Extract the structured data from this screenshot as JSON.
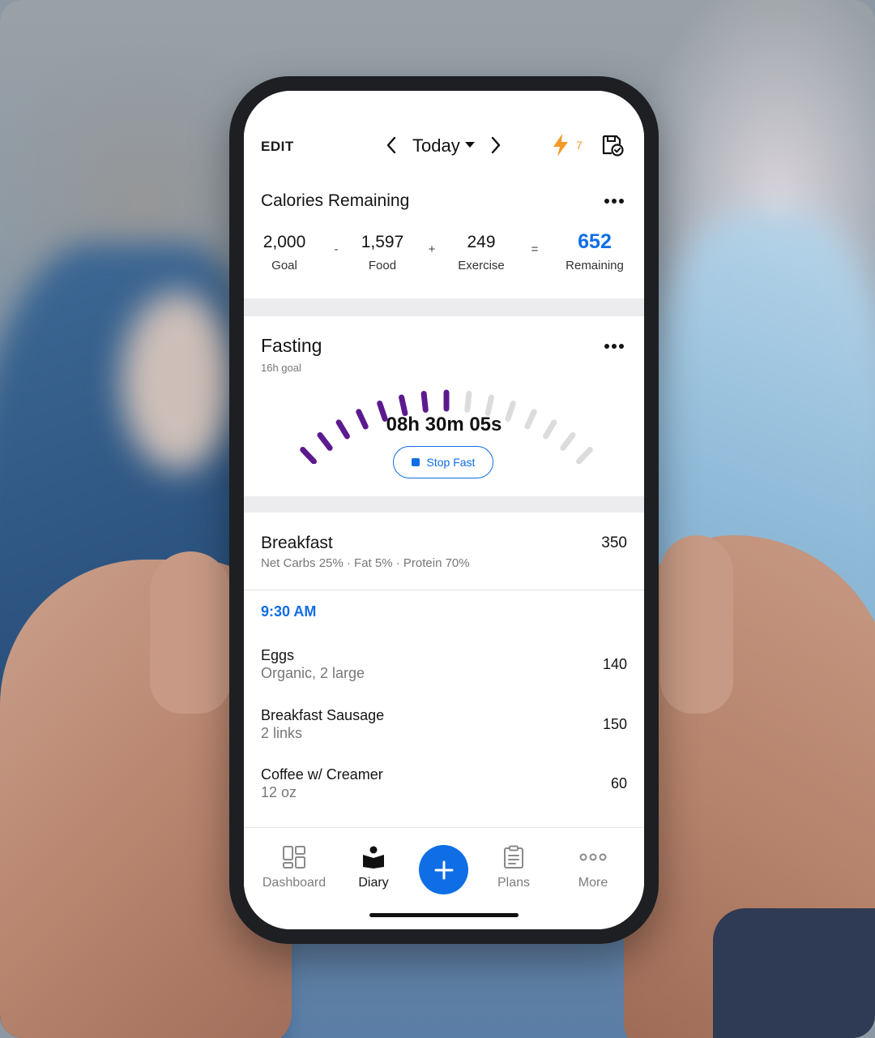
{
  "header": {
    "edit_label": "EDIT",
    "date_label": "Today",
    "streak_count": "7",
    "colors": {
      "streak": "#f39a2a"
    },
    "icons": [
      "chevron-left-icon",
      "chevron-right-icon",
      "caret-down-icon",
      "lightning-bolt-icon",
      "save-check-icon"
    ]
  },
  "calories": {
    "title": "Calories Remaining",
    "goal": {
      "value": "2,000",
      "label": "Goal"
    },
    "food": {
      "value": "1,597",
      "label": "Food"
    },
    "exercise": {
      "value": "249",
      "label": "Exercise"
    },
    "remaining": {
      "value": "652",
      "label": "Remaining"
    },
    "operators": {
      "minus": "-",
      "plus": "+",
      "equals": "="
    },
    "accent_color": "#0f6ee6"
  },
  "fasting": {
    "title": "Fasting",
    "goal_label": "16h goal",
    "timer": "08h 30m 05s",
    "stop_label": "Stop Fast",
    "progress_segments": 11,
    "total_segments": 21,
    "colors": {
      "active": "#5c1a8f",
      "inactive": "#dcdcde"
    }
  },
  "meal": {
    "title": "Breakfast",
    "calories": "350",
    "macros": "Net Carbs 25% · Fat 5% · Protein 70%",
    "time": "9:30 AM",
    "items": [
      {
        "name": "Eggs",
        "desc": "Organic, 2 large",
        "calories": "140"
      },
      {
        "name": "Breakfast Sausage",
        "desc": "2 links",
        "calories": "150"
      },
      {
        "name": "Coffee w/ Creamer",
        "desc": "12 oz",
        "calories": "60"
      }
    ]
  },
  "tabs": {
    "dashboard": "Dashboard",
    "diary": "Diary",
    "plans": "Plans",
    "more": "More",
    "active": "diary"
  }
}
